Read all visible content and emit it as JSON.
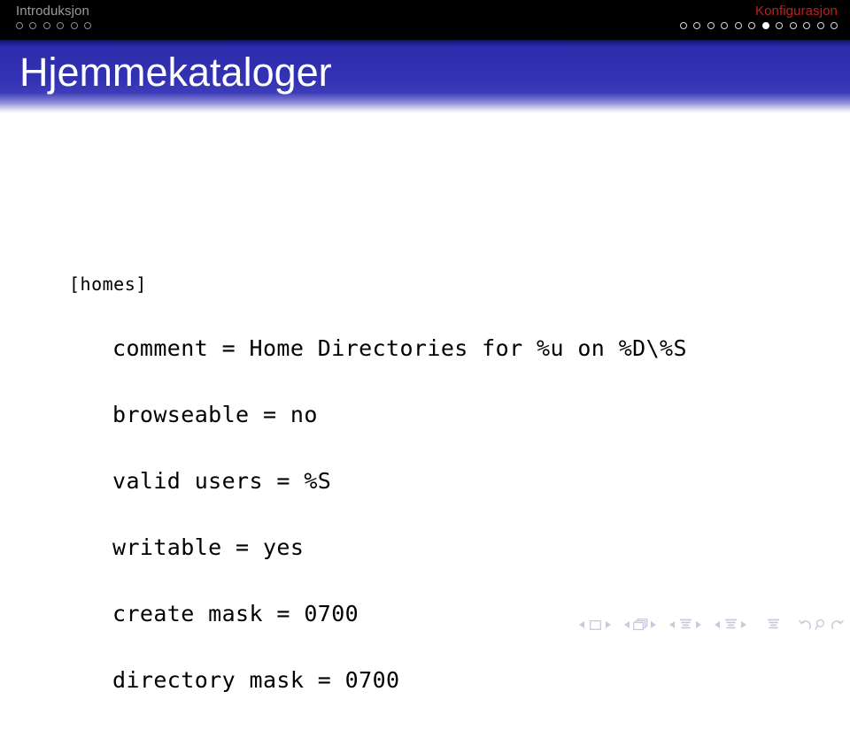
{
  "header": {
    "left": {
      "label": "Introduksjon",
      "dots_total": 6,
      "dots_filled_index": -1
    },
    "right": {
      "label": "Konfigurasjon",
      "dots_total": 12,
      "dots_filled_index": 6
    }
  },
  "slide": {
    "title": "Hjemmekataloger",
    "code": {
      "section": "[homes]",
      "lines": [
        "comment = Home Directories for %u on %D\\%S",
        "browseable = no",
        "valid users = %S",
        "writable = yes",
        "create mask = 0700",
        "directory mask = 0700"
      ]
    }
  },
  "navigation": {
    "items": [
      "prev-slide-arrow",
      "slide-icon",
      "next-slide-arrow",
      "prev-frame-arrow",
      "frame-icon",
      "next-frame-arrow",
      "prev-subsection-arrow",
      "subsection-icon",
      "next-subsection-arrow",
      "prev-section-arrow",
      "section-icon",
      "next-section-arrow",
      "presentation-icon",
      "back-icon",
      "find-icon",
      "forward-icon"
    ]
  },
  "colors": {
    "header_background": "#000000",
    "banner_blue": "#2b2bab",
    "right_title_red": "#bb2222",
    "left_title_gray": "#9b9b9f",
    "nav_icon": "#c9c9de",
    "code_text": "#000000"
  }
}
